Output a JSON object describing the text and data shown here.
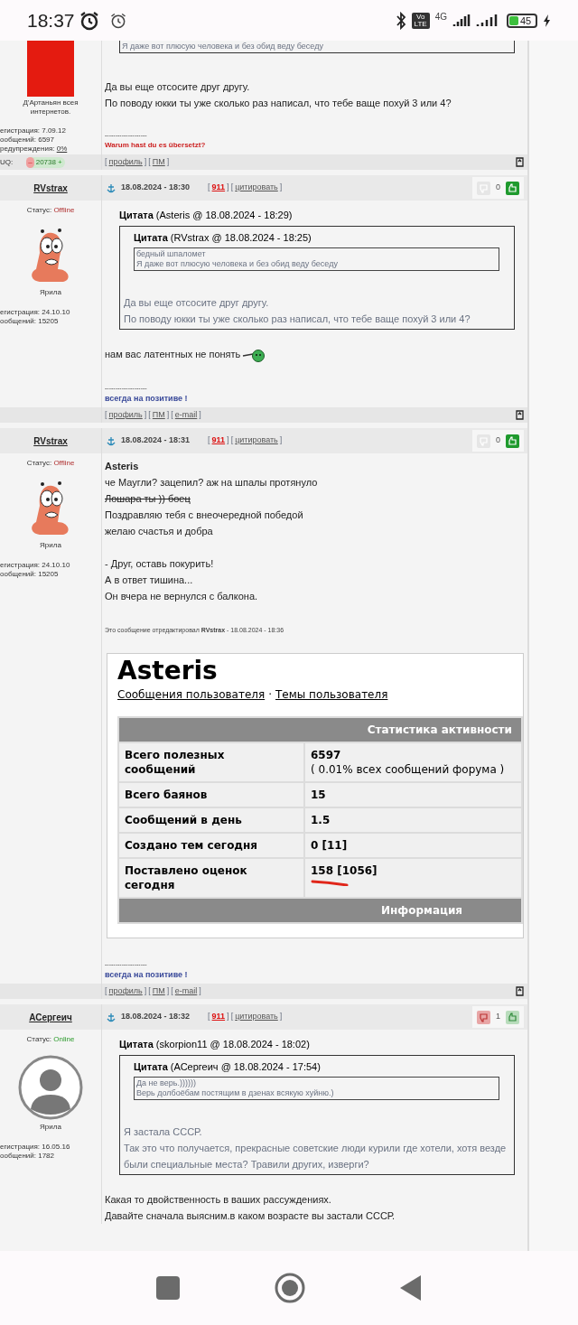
{
  "status_bar": {
    "time": "18:37",
    "volte": "Vo LTE",
    "network": "4G",
    "battery": "45"
  },
  "posts": [
    {
      "avatar": {
        "kind": "image"
      },
      "profile": {
        "title": "Д'Артаньян всея интернетов.",
        "reg": "егистрация: 7.09.12",
        "count": "ообщений: 6597",
        "warn_label": "редупреждения:",
        "warn_value": "0%"
      },
      "body": [
        {
          "kind": "quote_tail",
          "lines": [
            "Я даже вот плюсую человека и без обид веду беседу"
          ]
        },
        {
          "kind": "text",
          "text": "Да вы еще отсосите друг другу."
        },
        {
          "kind": "text",
          "text": "По поводу юкки ты уже сколько раз написал, что тебе ваще похуй 3 или 4?"
        }
      ],
      "signature": {
        "dashes": "--------------------",
        "text": "Warum hast du es übersetzt?",
        "color": "#cc2222"
      },
      "footer": {
        "rep": {
          "label": "UQ:",
          "minus": "–",
          "value": "20738",
          "plus": "+"
        },
        "links": [
          {
            "pre": "[",
            "label": "профиль",
            "post": "]"
          },
          {
            "pre": "[",
            "label": "ПМ",
            "post": "]"
          }
        ]
      }
    },
    {
      "author": "RVstrax",
      "date": "18.08.2024 - 18:30",
      "actions": [
        {
          "pre": "[",
          "label": "911",
          "post": "]",
          "kind": "report"
        },
        {
          "pre": "[",
          "label": "цитировать",
          "post": "]",
          "kind": "quote"
        }
      ],
      "rating": {
        "count": "0",
        "dislike_active": false,
        "like_active": true
      },
      "status": {
        "label": "Статус:",
        "value": "Offline",
        "online": false
      },
      "avatar": {
        "kind": "cartoon"
      },
      "profile": {
        "group": "Ярила",
        "reg": "егистрация: 24.10.10",
        "count": "ообщений: 15205"
      },
      "body": [
        {
          "kind": "quote",
          "header": "**Цитата** (Asteris @ 18.08.2024 - 18:29)",
          "inner_header": "**Цитата** (RVstrax @ 18.08.2024 - 18:25)",
          "inner_lines": [
            "бедный шпаломет",
            "Я даже вот  плюсую человека и без обид веду беседу"
          ],
          "lines": [
            "Да вы еще отсосите друг другу.",
            "По поводу юкки ты уже сколько раз написал, что тебе ваще похуй 3 или 4?"
          ]
        },
        {
          "kind": "text",
          "text": "нам вас латентных не понять",
          "smiley": true
        }
      ],
      "signature": {
        "dashes": "--------------------",
        "text": "всегда на позитиве !",
        "color": "#3a4a9a"
      },
      "footer": {
        "links": [
          {
            "pre": "[",
            "label": "профиль",
            "post": "]"
          },
          {
            "pre": "[",
            "label": "ПМ",
            "post": "]"
          },
          {
            "pre": "[",
            "label": "e-mail",
            "post": "]"
          }
        ]
      }
    },
    {
      "author": "RVstrax",
      "date": "18.08.2024 - 18:31",
      "actions": [
        {
          "pre": "[",
          "label": "911",
          "post": "]",
          "kind": "report"
        },
        {
          "pre": "[",
          "label": "цитировать",
          "post": "]",
          "kind": "quote"
        }
      ],
      "rating": {
        "count": "0",
        "dislike_active": false,
        "like_active": true
      },
      "status": {
        "label": "Статус:",
        "value": "Offline",
        "online": false
      },
      "avatar": {
        "kind": "cartoon"
      },
      "profile": {
        "group": "Ярила",
        "reg": "егистрация: 24.10.10",
        "count": "ообщений: 15205"
      },
      "body": [
        {
          "kind": "bold",
          "text": "Asteris"
        },
        {
          "kind": "text",
          "text": "че Маугли? зацепил? аж на шпалы протянуло"
        },
        {
          "kind": "strike",
          "text": "Лошара ты )) боец"
        },
        {
          "kind": "text",
          "text": "Поздравляю тебя с внеочередной победой"
        },
        {
          "kind": "text",
          "text": "желаю счастья и добра"
        },
        {
          "kind": "blank"
        },
        {
          "kind": "text",
          "text": "- Друг, оставь покурить!"
        },
        {
          "kind": "text",
          "text": "А в ответ тишина..."
        },
        {
          "kind": "text",
          "text": "Он вчера не вернулся с балкона."
        },
        {
          "kind": "edited",
          "text": "Это сообщение отредактировал **RVstrax** - 18.08.2024 - 18:36"
        },
        {
          "kind": "screenshot",
          "title": "Asteris",
          "links": [
            "Сообщения пользователя",
            "Темы пользователя"
          ],
          "separator": "·",
          "table_title": "Статистика активности",
          "rows": [
            {
              "label": "Всего полезных сообщений",
              "value": "6597",
              "note": "( 0.01% всех сообщений форума )",
              "marked": false
            },
            {
              "label": "Всего баянов",
              "value": "15",
              "marked": false
            },
            {
              "label": "Сообщений в день",
              "value": "1.5",
              "marked": false
            },
            {
              "label": "Создано тем сегодня",
              "value": "0 [11]",
              "marked": false
            },
            {
              "label": "Поставлено оценок сегодня",
              "value": "158 [1056]",
              "marked": true
            }
          ],
          "footer_title": "Информация"
        }
      ],
      "signature": {
        "dashes": "--------------------",
        "text": "всегда на позитиве !",
        "color": "#3a4a9a"
      },
      "footer": {
        "links": [
          {
            "pre": "[",
            "label": "профиль",
            "post": "]"
          },
          {
            "pre": "[",
            "label": "ПМ",
            "post": "]"
          },
          {
            "pre": "[",
            "label": "e-mail",
            "post": "]"
          }
        ]
      }
    },
    {
      "author": "АСергеич",
      "date": "18.08.2024 - 18:32",
      "actions": [
        {
          "pre": "[",
          "label": "911",
          "post": "]",
          "kind": "report"
        },
        {
          "pre": "[",
          "label": "цитировать",
          "post": "]",
          "kind": "quote"
        }
      ],
      "rating": {
        "count": "1",
        "dislike_active": true,
        "like_active": false
      },
      "status": {
        "label": "Статус:",
        "value": "Online",
        "online": true
      },
      "avatar": {
        "kind": "silhouette"
      },
      "profile": {
        "group": "Ярила",
        "reg": "егистрация: 16.05.16",
        "count": "ообщений: 1782"
      },
      "body": [
        {
          "kind": "quote",
          "header": "**Цитата** (skorpion11 @ 18.08.2024 - 18:02)",
          "inner_header": "**Цитата** (АСергеич @ 18.08.2024 - 17:54)",
          "inner_lines": [
            "Да не верь.))))))",
            "Верь долбоёбам постящим в дзенах всякую хуйню.)"
          ],
          "lines": [
            "Я застала СССР.",
            "Так это что получается, прекрасные советские люди курили где хотели, хотя везде были специальные места? Травили других, изверги?"
          ]
        },
        {
          "kind": "text",
          "text": "Какая то двойственность в ваших рассуждениях."
        },
        {
          "kind": "text",
          "text": "Давайте сначала выясним.в каком возрасте вы застали СССР."
        }
      ]
    }
  ]
}
